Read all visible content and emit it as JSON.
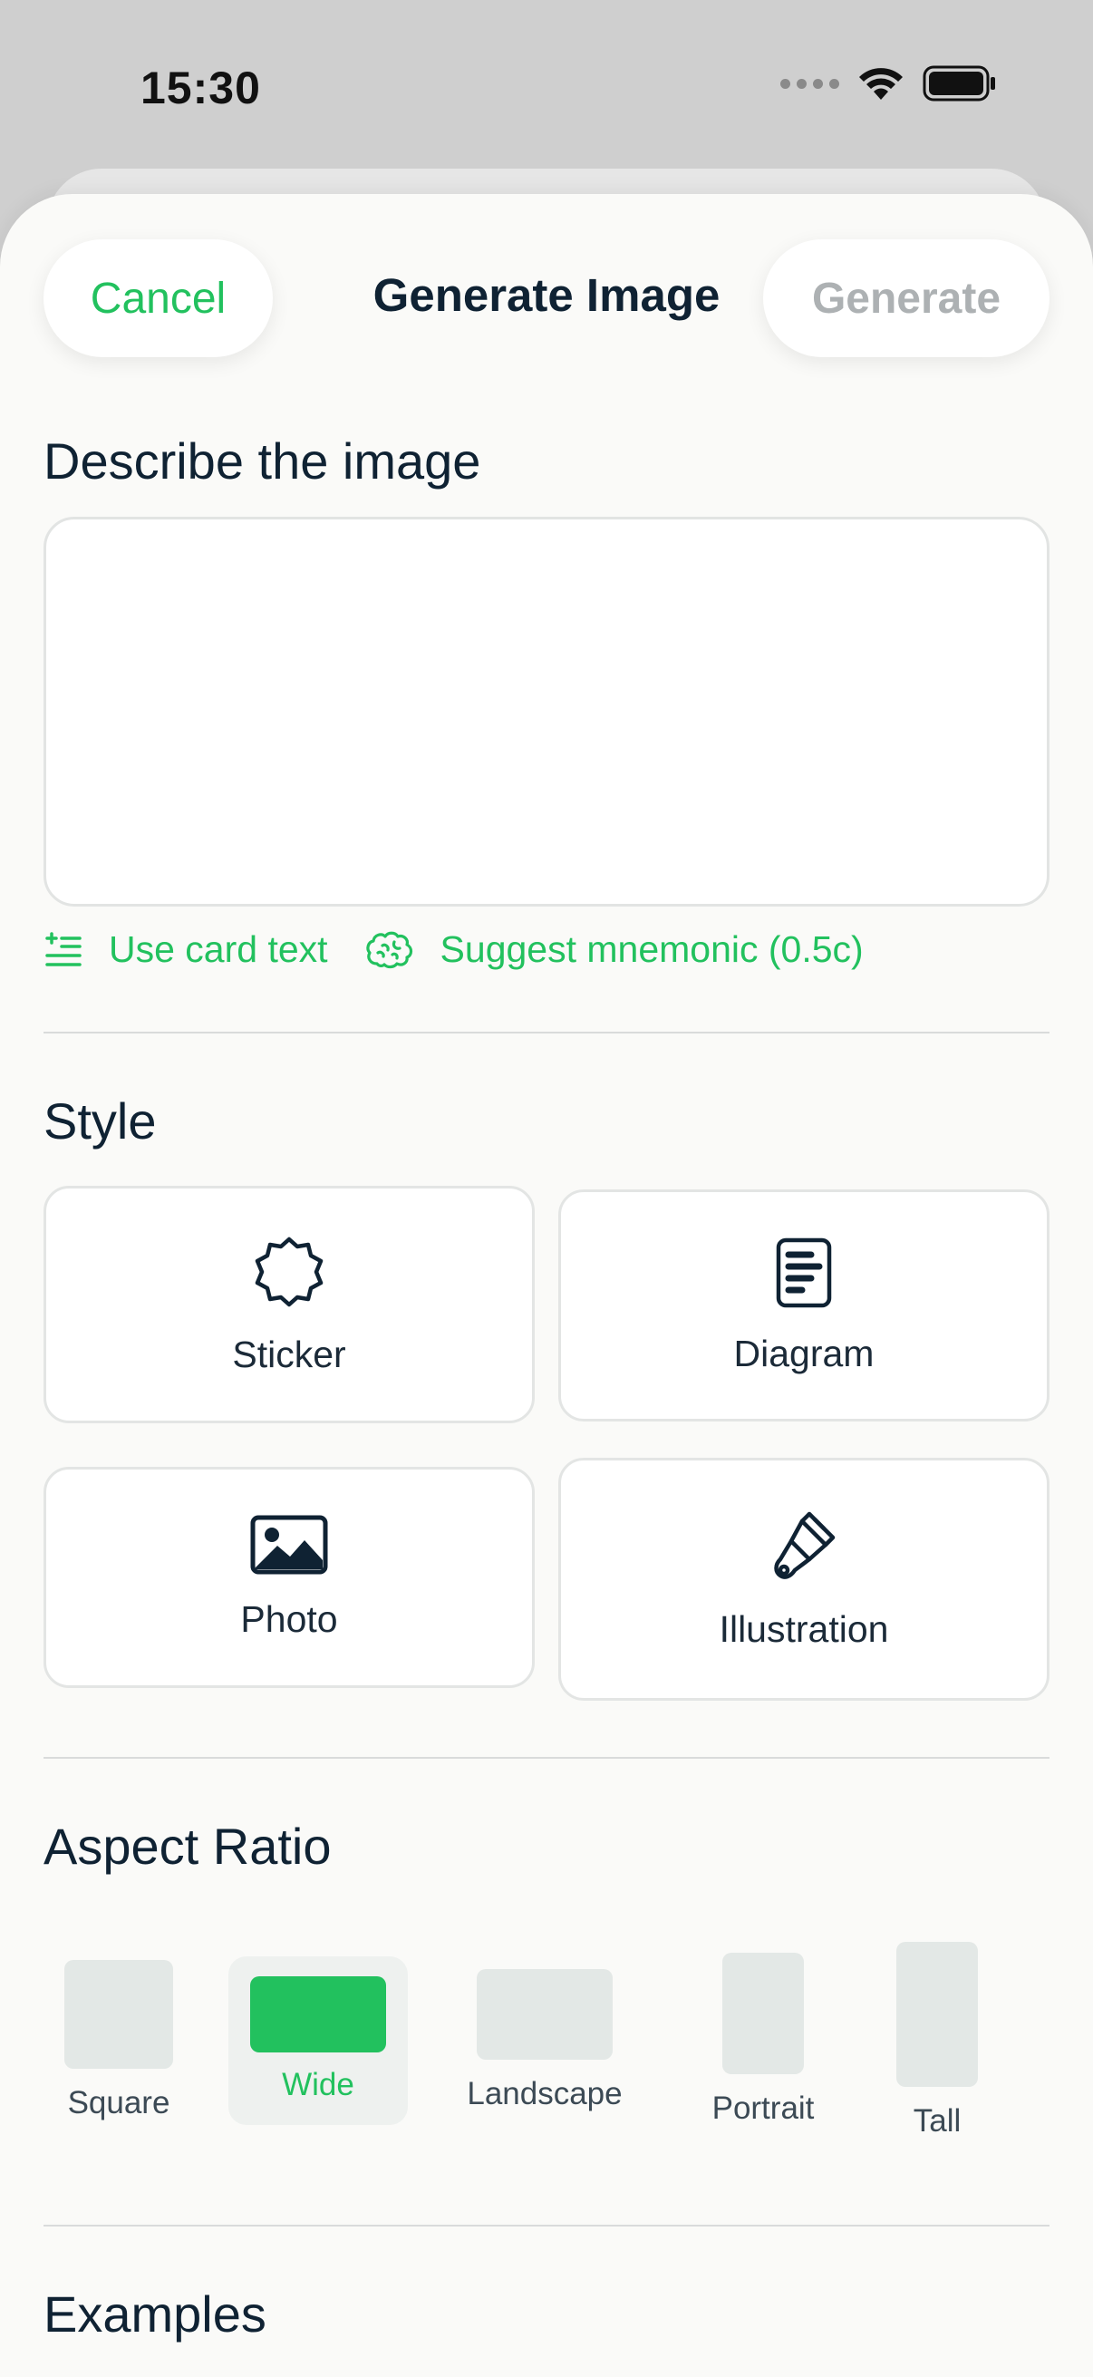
{
  "status_bar": {
    "time": "15:30"
  },
  "header": {
    "cancel_label": "Cancel",
    "title": "Generate Image",
    "generate_label": "Generate"
  },
  "describe": {
    "heading": "Describe the image",
    "value": "",
    "actions": [
      {
        "label": "Use card text",
        "icon": "card-text-icon"
      },
      {
        "label": "Suggest mnemonic (0.5c)",
        "icon": "brain-icon"
      }
    ]
  },
  "style": {
    "heading": "Style",
    "options": [
      {
        "label": "Sticker",
        "icon": "sticker-icon"
      },
      {
        "label": "Diagram",
        "icon": "diagram-icon"
      },
      {
        "label": "Photo",
        "icon": "photo-icon"
      },
      {
        "label": "Illustration",
        "icon": "brush-icon"
      }
    ]
  },
  "aspect_ratio": {
    "heading": "Aspect Ratio",
    "options": [
      {
        "label": "Square"
      },
      {
        "label": "Wide",
        "selected": true
      },
      {
        "label": "Landscape"
      },
      {
        "label": "Portrait"
      },
      {
        "label": "Tall"
      }
    ]
  },
  "examples": {
    "heading": "Examples"
  },
  "colors": {
    "accent": "#22c15e",
    "text": "#0f2233",
    "disabled": "#adb1b3",
    "shape_unselected": "#e3e8e6"
  }
}
